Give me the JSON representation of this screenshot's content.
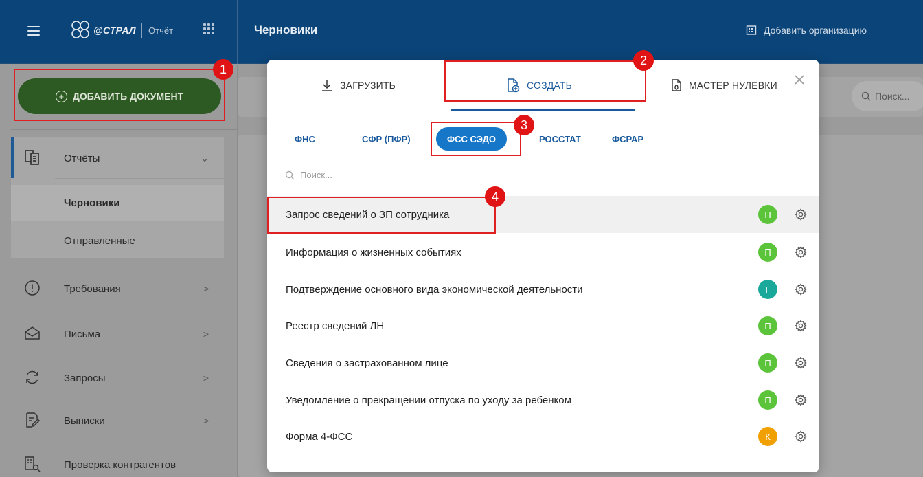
{
  "header": {
    "logo_text": "@СТРАЛ",
    "logo_sub": "Отчёт",
    "page_title": "Черновики",
    "add_org_label": "Добавить организацию"
  },
  "sidebar": {
    "add_document_label": "ДОБАВИТЬ ДОКУМЕНТ",
    "group": {
      "label": "Отчёты",
      "sub_items": [
        "Черновики",
        "Отправленные"
      ],
      "active": "Черновики"
    },
    "items": [
      {
        "label": "Требования",
        "icon": "alert-circle-icon"
      },
      {
        "label": "Письма",
        "icon": "envelope-icon"
      },
      {
        "label": "Запросы",
        "icon": "refresh-icon"
      },
      {
        "label": "Выписки",
        "icon": "document-edit-icon"
      },
      {
        "label": "Проверка контрагентов",
        "icon": "building-search-icon"
      }
    ]
  },
  "main": {
    "search_placeholder": "Поиск..."
  },
  "modal": {
    "tabs": [
      {
        "label": "ЗАГРУЗИТЬ",
        "icon": "download-icon"
      },
      {
        "label": "СОЗДАТЬ",
        "icon": "file-add-icon",
        "active": true
      },
      {
        "label": "МАСТЕР НУЛЕВКИ",
        "icon": "file-zero-icon"
      }
    ],
    "categories": [
      "ФНС",
      "СФР (ПФР)",
      "ФСС СЭДО",
      "РОССТАТ",
      "ФСРАР"
    ],
    "active_category": "ФСС СЭДО",
    "search_placeholder": "Поиск...",
    "documents": [
      {
        "title": "Запрос сведений о ЗП сотрудника",
        "avatar": "П",
        "color": "#5cc43a"
      },
      {
        "title": "Информация о жизненных событиях",
        "avatar": "П",
        "color": "#5cc43a"
      },
      {
        "title": "Подтверждение основного вида экономической деятельности",
        "avatar": "Г",
        "color": "#1aa89a"
      },
      {
        "title": "Реестр сведений ЛН",
        "avatar": "П",
        "color": "#5cc43a"
      },
      {
        "title": "Сведения о застрахованном лице",
        "avatar": "П",
        "color": "#5cc43a"
      },
      {
        "title": "Уведомление о прекращении отпуска по уходу за ребенком",
        "avatar": "П",
        "color": "#5cc43a"
      },
      {
        "title": "Форма 4-ФСС",
        "avatar": "К",
        "color": "#f0a000"
      }
    ]
  },
  "callouts": [
    "1",
    "2",
    "3",
    "4"
  ],
  "colors": {
    "topbar": "#0b4478",
    "accent": "#1a5a9c",
    "highlight": "#e02020",
    "add_button": "#2d5a22"
  }
}
